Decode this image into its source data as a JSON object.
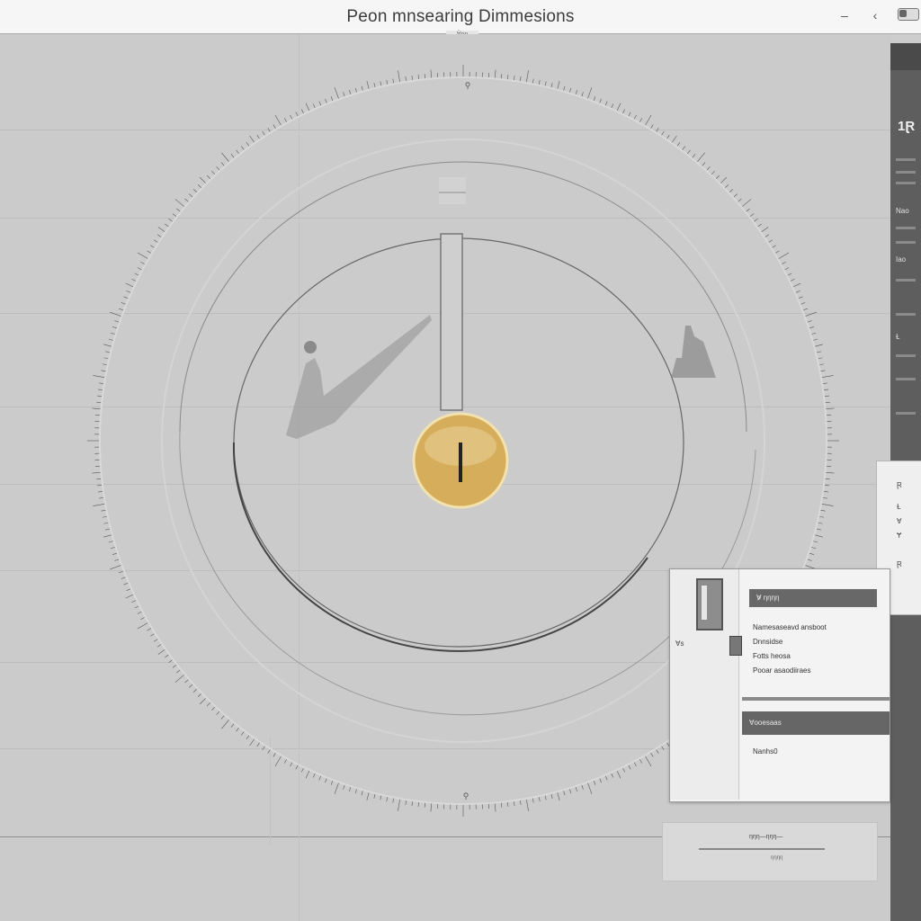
{
  "window": {
    "title": "Peon mnsearing Dimmesions",
    "subtitle": "Ɐ̈ƞƞ",
    "back_icon": "chevron-left-icon",
    "minimize_icon": "minimize-icon",
    "toggle_icon": "toggle-icon"
  },
  "rail": {
    "number": "1Ɽ",
    "labels": [
      "Nao",
      "Iao",
      "Ɫ"
    ]
  },
  "mini_panel": {
    "rows": [
      "Ɽ",
      "Ɫ",
      "Ɐ",
      "Ɏ",
      "Ɽ"
    ]
  },
  "properties": {
    "tag": "Ɐs",
    "header": "Ɐ̵̷  ƞƞƞƞ",
    "lines": [
      "Namesaseavd ansboot",
      "Dnnsidse",
      "Fotts heosa",
      "Pooar asaodiiraes"
    ],
    "selected": "Ɐooesaas",
    "footer": "Nanhs0"
  },
  "notice": {
    "line": "ƞƞƞ—ƞƞƞ—",
    "sub": "ƞƞƞƞ"
  },
  "colors": {
    "knob": "#d6ad5a",
    "canvas": "#cbcbcb",
    "rail": "#5e5e5e"
  }
}
